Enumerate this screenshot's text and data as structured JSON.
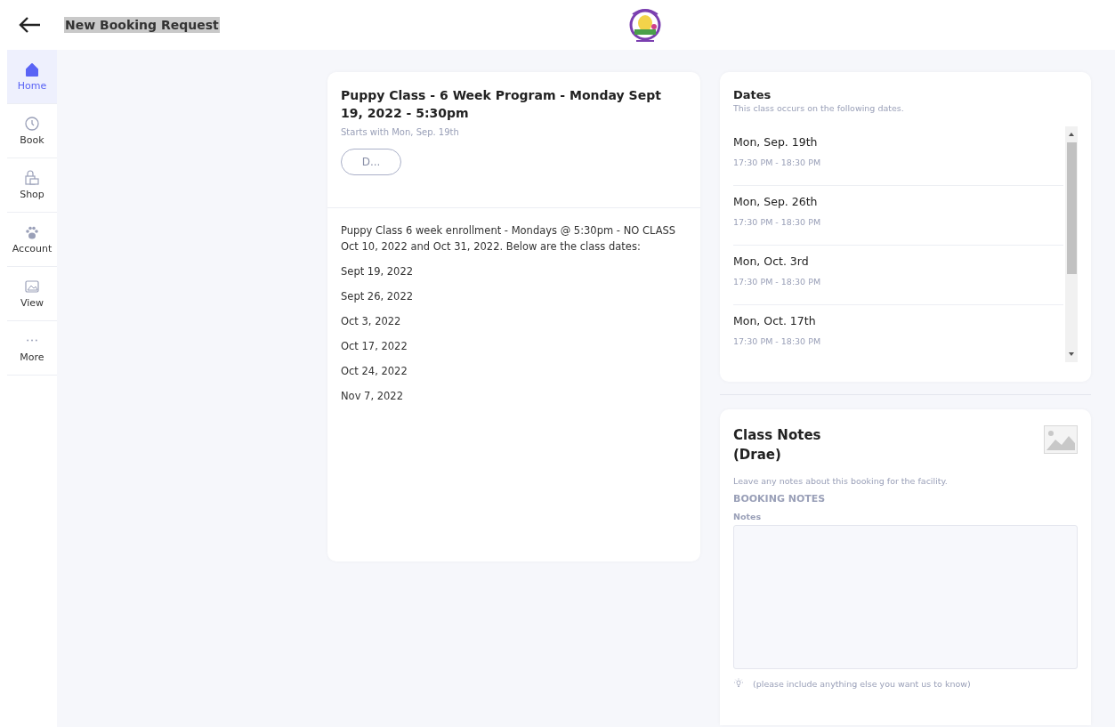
{
  "header": {
    "title": "New Booking Request"
  },
  "sidebar": {
    "items": [
      {
        "label": "Home",
        "kind": "home",
        "selected": true
      },
      {
        "label": "Book",
        "kind": "clock",
        "selected": false
      },
      {
        "label": "Shop",
        "kind": "bag",
        "selected": false
      },
      {
        "label": "Account",
        "kind": "paw",
        "selected": false
      },
      {
        "label": "View",
        "kind": "image",
        "selected": false
      },
      {
        "label": "More",
        "kind": "dots",
        "selected": false
      }
    ]
  },
  "class_card": {
    "title": "Puppy Class - 6 Week Program - Monday Sept 19, 2022 - 5:30pm",
    "subtitle": "Starts with Mon, Sep. 19th",
    "button": "D...",
    "description": "Puppy Class 6 week enrollment - Mondays @ 5:30pm - NO CLASS Oct 10, 2022 and Oct 31, 2022.  Below are the class dates:",
    "dates": [
      "Sept 19, 2022",
      "Sept 26, 2022",
      "Oct 3, 2022",
      "Oct 17, 2022",
      "Oct 24, 2022",
      "Nov 7, 2022"
    ]
  },
  "dates_card": {
    "title": "Dates",
    "subtitle": "This class occurs on the following dates.",
    "items": [
      {
        "date": "Mon, Sep. 19th",
        "time": "17:30 PM - 18:30 PM"
      },
      {
        "date": "Mon, Sep. 26th",
        "time": "17:30 PM - 18:30 PM"
      },
      {
        "date": "Mon, Oct. 3rd",
        "time": "17:30 PM - 18:30 PM"
      },
      {
        "date": "Mon, Oct. 17th",
        "time": "17:30 PM - 18:30 PM"
      }
    ]
  },
  "notes_card": {
    "title": "Class Notes",
    "pet": "(Drae)",
    "hint": "Leave any notes about this booking for the facility.",
    "section": "BOOKING NOTES",
    "field_label": "Notes",
    "tip": "(please include anything else you want us to know)"
  }
}
